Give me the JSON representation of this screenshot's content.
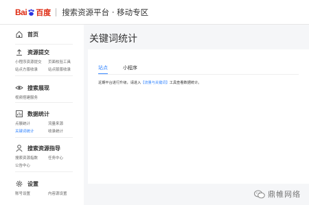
{
  "header": {
    "logo_bai": "Bai",
    "logo_du": "百度",
    "platform_title": "搜索资源平台 · 移动专区"
  },
  "sidebar": {
    "home": "首页",
    "resource_submit": {
      "title": "资源提交",
      "items": [
        "小程序资源提交",
        "页面校验工具",
        "站点方版收录",
        "站点版版收录"
      ]
    },
    "search_display": {
      "title": "搜索展现",
      "items": [
        "视频搭建服务"
      ]
    },
    "data_stats": {
      "title": "数据统计",
      "items": [
        "点展统计",
        "流量来源",
        "关键词统计",
        "收录统计"
      ]
    },
    "search_guide": {
      "title": "搜索资源指导",
      "items": [
        "搜索资源指数",
        "任务中心",
        "公告中心"
      ]
    },
    "settings": {
      "title": "设置",
      "items": [
        "账号设置",
        "内容源设置"
      ]
    }
  },
  "main": {
    "title": "关键词统计",
    "tabs": [
      {
        "label": "站点",
        "active": true
      },
      {
        "label": "小程序",
        "active": false
      }
    ],
    "notice_prefix": "近期平台进行升级，请进入",
    "notice_link": "【流量与关键词】",
    "notice_suffix": "工具查看数据统计。"
  },
  "watermark": {
    "text": "鼎帷网络"
  },
  "colors": {
    "brand_red": "#de2910",
    "link_blue": "#3385ff"
  }
}
